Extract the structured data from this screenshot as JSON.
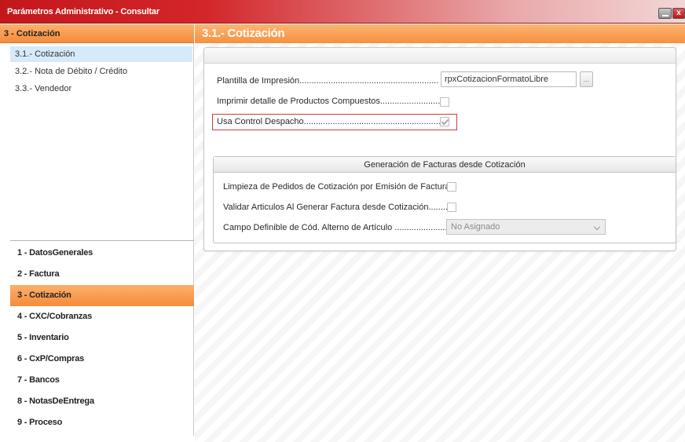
{
  "window": {
    "title": "Parámetros Administrativo - Consultar",
    "close_glyph": "x"
  },
  "left": {
    "header": "3 - Cotización",
    "subnav": [
      {
        "label": "3.1.- Cotización",
        "selected": true
      },
      {
        "label": "3.2.- Nota de Débito / Crédito",
        "selected": false
      },
      {
        "label": "3.3.- Vendedor",
        "selected": false
      }
    ],
    "nav": [
      {
        "label": "1 - DatosGenerales",
        "active": false
      },
      {
        "label": "2 - Factura",
        "active": false
      },
      {
        "label": "3 - Cotización",
        "active": true
      },
      {
        "label": "4 - CXC/Cobranzas",
        "active": false
      },
      {
        "label": "5 - Inventario",
        "active": false
      },
      {
        "label": "6 - CxP/Compras",
        "active": false
      },
      {
        "label": "7 - Bancos",
        "active": false
      },
      {
        "label": "8 - NotasDeEntrega",
        "active": false
      },
      {
        "label": "9 - Proceso",
        "active": false
      }
    ]
  },
  "main": {
    "header": "3.1.- Cotización",
    "plantilla": {
      "label": "Plantilla de Impresión..........................................................",
      "value": "rpxCotizacionFormatoLibre",
      "button": "..."
    },
    "imprimir": {
      "label": "Imprimir detalle de Productos Compuestos.........................",
      "checked": false
    },
    "usa_control": {
      "label": "Usa Control Despacho..........................................................",
      "checked": true
    },
    "group": {
      "title": "Generación de Facturas desde Cotización",
      "limpieza": {
        "label": "Limpieza de Pedidos de Cotización por Emisión de Factura",
        "checked": false
      },
      "validar": {
        "label": "Validar Articulos Al Generar Factura desde Cotización........",
        "checked": false
      },
      "campo": {
        "label": "Campo Definible de Cód. Alterno de Artículo ......................",
        "value": "No Asignado"
      }
    }
  },
  "colors": {
    "titlebar": "#c4171c",
    "accent_orange": "#f58b3a",
    "selected_blue": "#d6eafa",
    "highlight_red": "#d23a3a"
  }
}
